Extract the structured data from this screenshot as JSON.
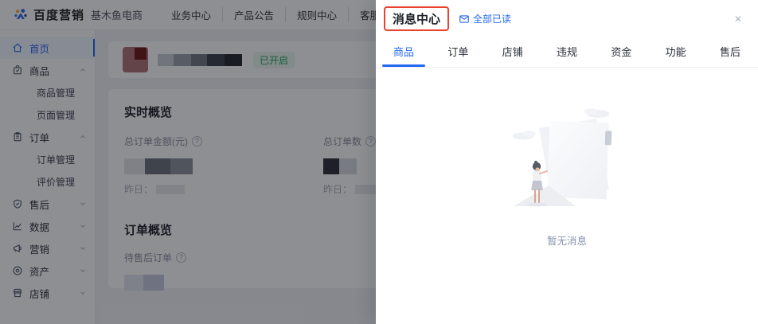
{
  "topbar": {
    "brand": "百度营销",
    "brand_sub": "基木鱼电商",
    "nav": [
      {
        "label": "业务中心"
      },
      {
        "label": "产品公告"
      },
      {
        "label": "规则中心"
      },
      {
        "label": "客服工作台"
      }
    ]
  },
  "sidebar": {
    "items": [
      {
        "label": "首页",
        "icon": "home-icon",
        "active": true
      },
      {
        "label": "商品",
        "icon": "goods-icon",
        "expanded": true
      },
      {
        "label": "商品管理",
        "child": true
      },
      {
        "label": "页面管理",
        "child": true
      },
      {
        "label": "订单",
        "icon": "orders-icon",
        "expanded": true
      },
      {
        "label": "订单管理",
        "child": true
      },
      {
        "label": "评价管理",
        "child": true
      },
      {
        "label": "售后",
        "icon": "aftersale-icon",
        "expanded": false
      },
      {
        "label": "数据",
        "icon": "data-icon",
        "expanded": false
      },
      {
        "label": "营销",
        "icon": "marketing-icon",
        "expanded": false
      },
      {
        "label": "资产",
        "icon": "assets-icon",
        "expanded": false
      },
      {
        "label": "店铺",
        "icon": "shop-icon",
        "expanded": false
      }
    ]
  },
  "main": {
    "welcome": {
      "status_badge": "已开启"
    },
    "realtime": {
      "title": "实时概览",
      "stat1_label": "总订单金额(元)",
      "stat2_label": "总订单数",
      "yesterday_label": "昨日："
    },
    "orders": {
      "title": "订单概览",
      "stat1_label": "待售后订单"
    }
  },
  "drawer": {
    "title": "消息中心",
    "mark_all_read_label": "全部已读",
    "close_label": "✕",
    "tabs": [
      {
        "label": "商品",
        "active": true
      },
      {
        "label": "订单",
        "active": false
      },
      {
        "label": "店铺",
        "active": false
      },
      {
        "label": "违规",
        "active": false
      },
      {
        "label": "资金",
        "active": false
      },
      {
        "label": "功能",
        "active": false
      },
      {
        "label": "售后",
        "active": false
      }
    ],
    "empty_text": "暂无消息"
  },
  "colors": {
    "accent_blue": "#2468F2",
    "success_green": "#23A05B",
    "annotation_red": "#E8432C"
  }
}
